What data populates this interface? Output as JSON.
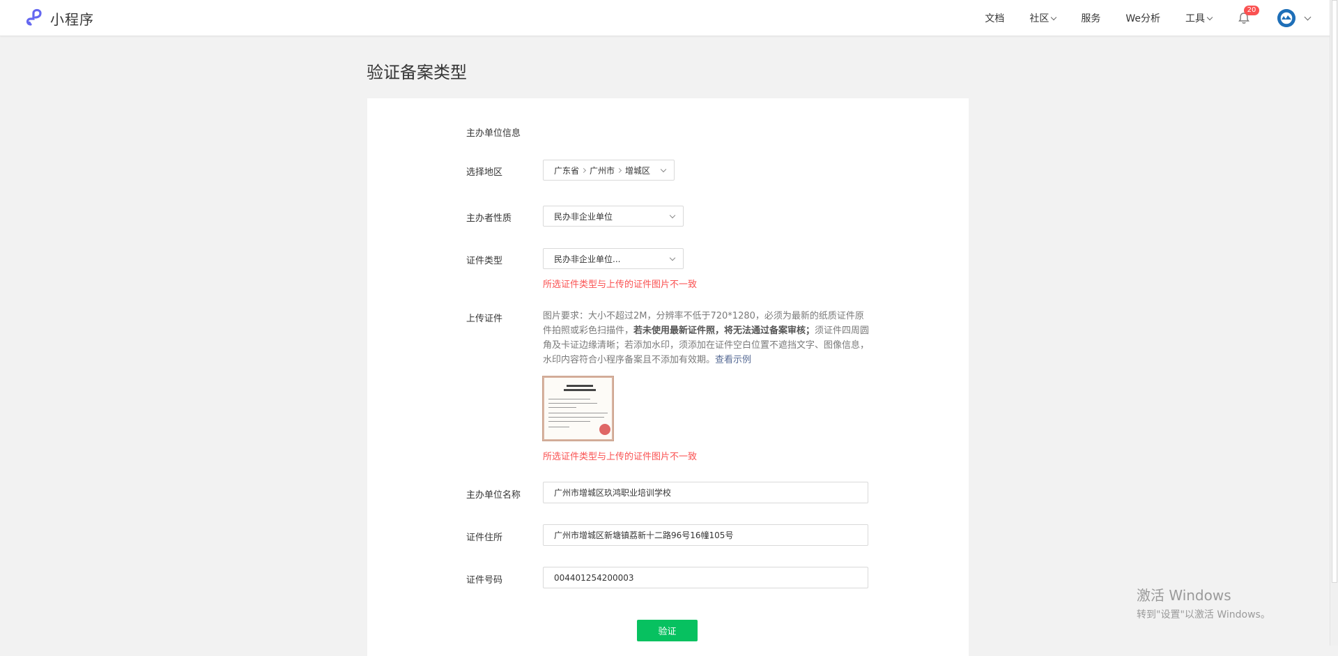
{
  "header": {
    "brand_name": "小程序",
    "nav": [
      {
        "label": "文档",
        "dropdown": false
      },
      {
        "label": "社区",
        "dropdown": true
      },
      {
        "label": "服务",
        "dropdown": false
      },
      {
        "label": "We分析",
        "dropdown": false
      },
      {
        "label": "工具",
        "dropdown": true
      }
    ],
    "notification_count": "20",
    "icons": {
      "logo": "mini-program-logo-icon",
      "bell": "bell-icon",
      "avatar": "avatar-image"
    },
    "colors": {
      "brand": "#6467f0",
      "badge": "#fa5151"
    }
  },
  "page": {
    "title": "验证备案类型",
    "section_title": "主办单位信息"
  },
  "form": {
    "region": {
      "label": "选择地区",
      "province": "广东省",
      "city": "广州市",
      "district": "增城区"
    },
    "organizer_type": {
      "label": "主办者性质",
      "value": "民办非企业单位"
    },
    "cert_type": {
      "label": "证件类型",
      "value": "民办非企业单位...",
      "error": "所选证件类型与上传的证件图片不一致"
    },
    "upload": {
      "label": "上传证件",
      "req_part1": "图片要求：大小不超过2M，分辨率不低于720*1280，必须为最新的纸质证件原件拍照或彩色扫描件，",
      "req_bold": "若未使用最新证件照，将无法通过备案审核；",
      "req_part2": "须证件四周圆角及卡证边缘清晰；若添加水印，须添加在证件空白位置不遮挡文字、图像信息，水印内容符合小程序备案且不添加有效期。",
      "example_link": "查看示例",
      "error": "所选证件类型与上传的证件图片不一致"
    },
    "org_name": {
      "label": "主办单位名称",
      "value": "广州市增城区玖鸿职业培训学校"
    },
    "cert_address": {
      "label": "证件住所",
      "value": "广州市增城区新塘镇荔新十二路96号16幢105号"
    },
    "cert_number": {
      "label": "证件号码",
      "value": "004401254200003"
    },
    "submit_label": "验证",
    "colors": {
      "error": "#fa5151",
      "primary_button": "#07c160",
      "link": "#576b95"
    }
  },
  "watermark": {
    "title": "激活 Windows",
    "subtitle": "转到\"设置\"以激活 Windows。"
  }
}
